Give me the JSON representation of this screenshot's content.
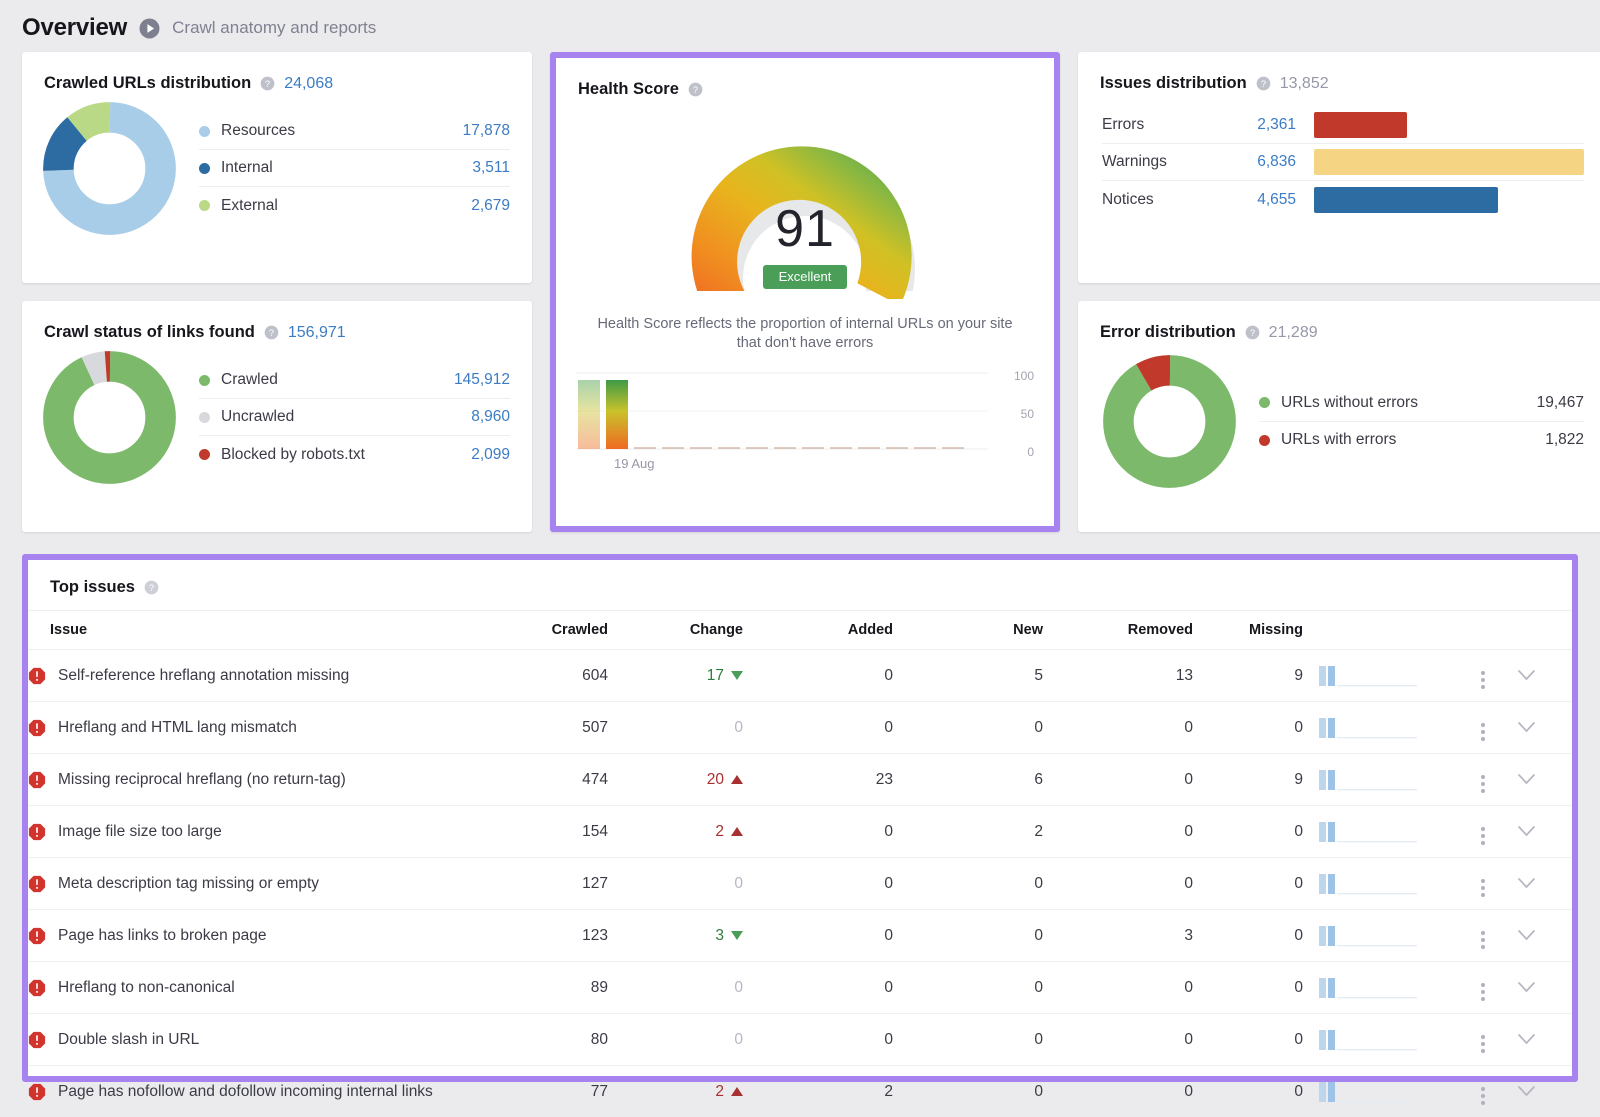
{
  "header": {
    "title": "Overview",
    "play_icon": "play-circle-icon",
    "subtitle": "Crawl anatomy and reports"
  },
  "colors": {
    "accent_purple": "#a683ef",
    "link_blue": "#3b7cc4",
    "error_red": "#c0392b",
    "warning_yellow": "#f5d583",
    "notice_blue": "#2d6ba3",
    "green": "#7cb96b",
    "grey": "#d8d9dd"
  },
  "crawled_urls": {
    "title": "Crawled URLs distribution",
    "help_icon": "help-circle-icon",
    "total": "24,068",
    "chart_data": {
      "type": "pie",
      "title": "Crawled URLs distribution",
      "categories": [
        "Resources",
        "Internal",
        "External"
      ],
      "values": [
        17878,
        3511,
        2679
      ],
      "labels": [
        "17,878",
        "3,511",
        "2,679"
      ],
      "colors": [
        "#a8cde8",
        "#2d6ba3",
        "#b9d986"
      ],
      "total": 24068
    }
  },
  "crawl_status": {
    "title": "Crawl status of links found",
    "help_icon": "help-circle-icon",
    "total": "156,971",
    "chart_data": {
      "type": "pie",
      "title": "Crawl status of links found",
      "categories": [
        "Crawled",
        "Uncrawled",
        "Blocked by robots.txt"
      ],
      "values": [
        145912,
        8960,
        2099
      ],
      "labels": [
        "145,912",
        "8,960",
        "2,099"
      ],
      "colors": [
        "#7cb96b",
        "#d8d9dd",
        "#c0392b"
      ],
      "total": 156971
    }
  },
  "health_score": {
    "title": "Health Score",
    "help_icon": "help-circle-icon",
    "score": "91",
    "badge": "Excellent",
    "description": "Health Score reflects the proportion of internal URLs on your site that don't have errors",
    "chart_data": {
      "type": "bar",
      "title": "Health Score history",
      "categories": [
        "19 Aug",
        "",
        "",
        "",
        "",
        "",
        "",
        "",
        "",
        "",
        "",
        ""
      ],
      "values": [
        91,
        91,
        0,
        0,
        0,
        0,
        0,
        0,
        0,
        0,
        0,
        0
      ],
      "xlabel": "",
      "ylabel": "",
      "ylim": [
        0,
        100
      ],
      "yticks": [
        "0",
        "50",
        "100"
      ],
      "xtick_label": "19 Aug",
      "gauge_value": 91,
      "gauge_max": 100
    }
  },
  "issues_distribution": {
    "title": "Issues distribution",
    "help_icon": "help-circle-icon",
    "total": "13,852",
    "chart_data": {
      "type": "bar",
      "title": "Issues distribution",
      "categories": [
        "Errors",
        "Warnings",
        "Notices"
      ],
      "values": [
        2361,
        6836,
        4655
      ],
      "labels": [
        "2,361",
        "6,836",
        "4,655"
      ],
      "colors": [
        "#c0392b",
        "#f5d583",
        "#2d6ba3"
      ],
      "total": 13852,
      "orientation": "horizontal"
    }
  },
  "error_distribution": {
    "title": "Error distribution",
    "help_icon": "help-circle-icon",
    "total": "21,289",
    "chart_data": {
      "type": "pie",
      "title": "Error distribution",
      "categories": [
        "URLs without errors",
        "URLs with errors"
      ],
      "values": [
        19467,
        1822
      ],
      "labels": [
        "19,467",
        "1,822"
      ],
      "colors": [
        "#7cb96b",
        "#c0392b"
      ],
      "total": 21289
    }
  },
  "top_issues": {
    "title": "Top issues",
    "help_icon": "help-circle-icon",
    "columns": [
      "Issue",
      "Crawled",
      "Change",
      "Added",
      "New",
      "Removed",
      "Missing"
    ],
    "rows": [
      {
        "icon": "error-icon",
        "issue": "Self-reference hreflang annotation missing",
        "crawled": "604",
        "change": "17",
        "change_dir": "down",
        "added": "0",
        "added_state": "zero",
        "new": "5",
        "new_state": "red",
        "removed": "13",
        "removed_state": "green",
        "missing": "9",
        "missing_state": "green"
      },
      {
        "icon": "error-icon",
        "issue": "Hreflang and HTML lang mismatch",
        "crawled": "507",
        "change": "0",
        "change_dir": "none",
        "added": "0",
        "added_state": "zero",
        "new": "0",
        "new_state": "zero",
        "removed": "0",
        "removed_state": "zero",
        "missing": "0",
        "missing_state": "zero"
      },
      {
        "icon": "error-icon",
        "issue": "Missing reciprocal hreflang (no return-tag)",
        "crawled": "474",
        "change": "20",
        "change_dir": "up",
        "added": "23",
        "added_state": "red",
        "new": "6",
        "new_state": "red",
        "removed": "0",
        "removed_state": "zero",
        "missing": "9",
        "missing_state": "green"
      },
      {
        "icon": "error-icon",
        "issue": "Image file size too large",
        "crawled": "154",
        "change": "2",
        "change_dir": "up",
        "added": "0",
        "added_state": "zero",
        "new": "2",
        "new_state": "red",
        "removed": "0",
        "removed_state": "zero",
        "missing": "0",
        "missing_state": "zero"
      },
      {
        "icon": "error-icon",
        "issue": "Meta description tag missing or empty",
        "crawled": "127",
        "change": "0",
        "change_dir": "none",
        "added": "0",
        "added_state": "zero",
        "new": "0",
        "new_state": "zero",
        "removed": "0",
        "removed_state": "zero",
        "missing": "0",
        "missing_state": "zero"
      },
      {
        "icon": "error-icon",
        "issue": "Page has links to broken page",
        "crawled": "123",
        "change": "3",
        "change_dir": "down",
        "added": "0",
        "added_state": "zero",
        "new": "0",
        "new_state": "zero",
        "removed": "3",
        "removed_state": "green",
        "missing": "0",
        "missing_state": "zero"
      },
      {
        "icon": "error-icon",
        "issue": "Hreflang to non-canonical",
        "crawled": "89",
        "change": "0",
        "change_dir": "none",
        "added": "0",
        "added_state": "zero",
        "new": "0",
        "new_state": "zero",
        "removed": "0",
        "removed_state": "zero",
        "missing": "0",
        "missing_state": "zero"
      },
      {
        "icon": "error-icon",
        "issue": "Double slash in URL",
        "crawled": "80",
        "change": "0",
        "change_dir": "none",
        "added": "0",
        "added_state": "zero",
        "new": "0",
        "new_state": "zero",
        "removed": "0",
        "removed_state": "zero",
        "missing": "0",
        "missing_state": "zero"
      },
      {
        "icon": "error-icon",
        "issue": "Page has nofollow and dofollow incoming internal links",
        "crawled": "77",
        "change": "2",
        "change_dir": "up",
        "added": "2",
        "added_state": "red",
        "new": "0",
        "new_state": "zero",
        "removed": "0",
        "removed_state": "zero",
        "missing": "0",
        "missing_state": "zero"
      }
    ],
    "row_menu_icon": "kebab-menu-icon",
    "row_expand_icon": "chevron-down-icon"
  }
}
